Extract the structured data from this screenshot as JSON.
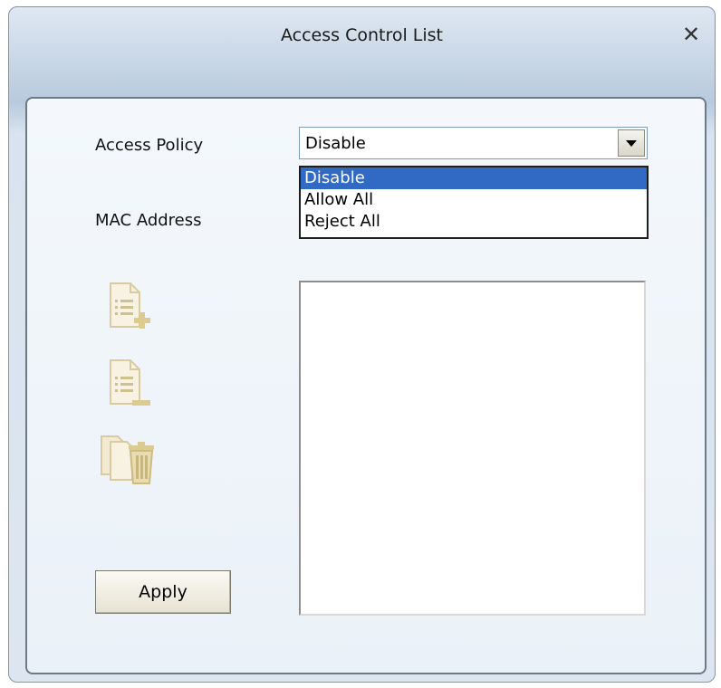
{
  "window": {
    "title": "Access Control List",
    "close_icon": "close-icon"
  },
  "form": {
    "access_policy_label": "Access Policy",
    "mac_address_label": "MAC Address",
    "access_policy": {
      "selected": "Disable",
      "options": [
        "Disable",
        "Allow All",
        "Reject All"
      ],
      "highlighted": "Disable"
    },
    "mac_list_items": []
  },
  "toolbar": {
    "icons": [
      "add-entry-icon",
      "remove-entry-icon",
      "delete-all-icon"
    ],
    "icon_color": "#d9caa0"
  },
  "actions": {
    "apply_label": "Apply"
  },
  "colors": {
    "selection": "#316ac5",
    "window_border": "#7f95ad"
  }
}
